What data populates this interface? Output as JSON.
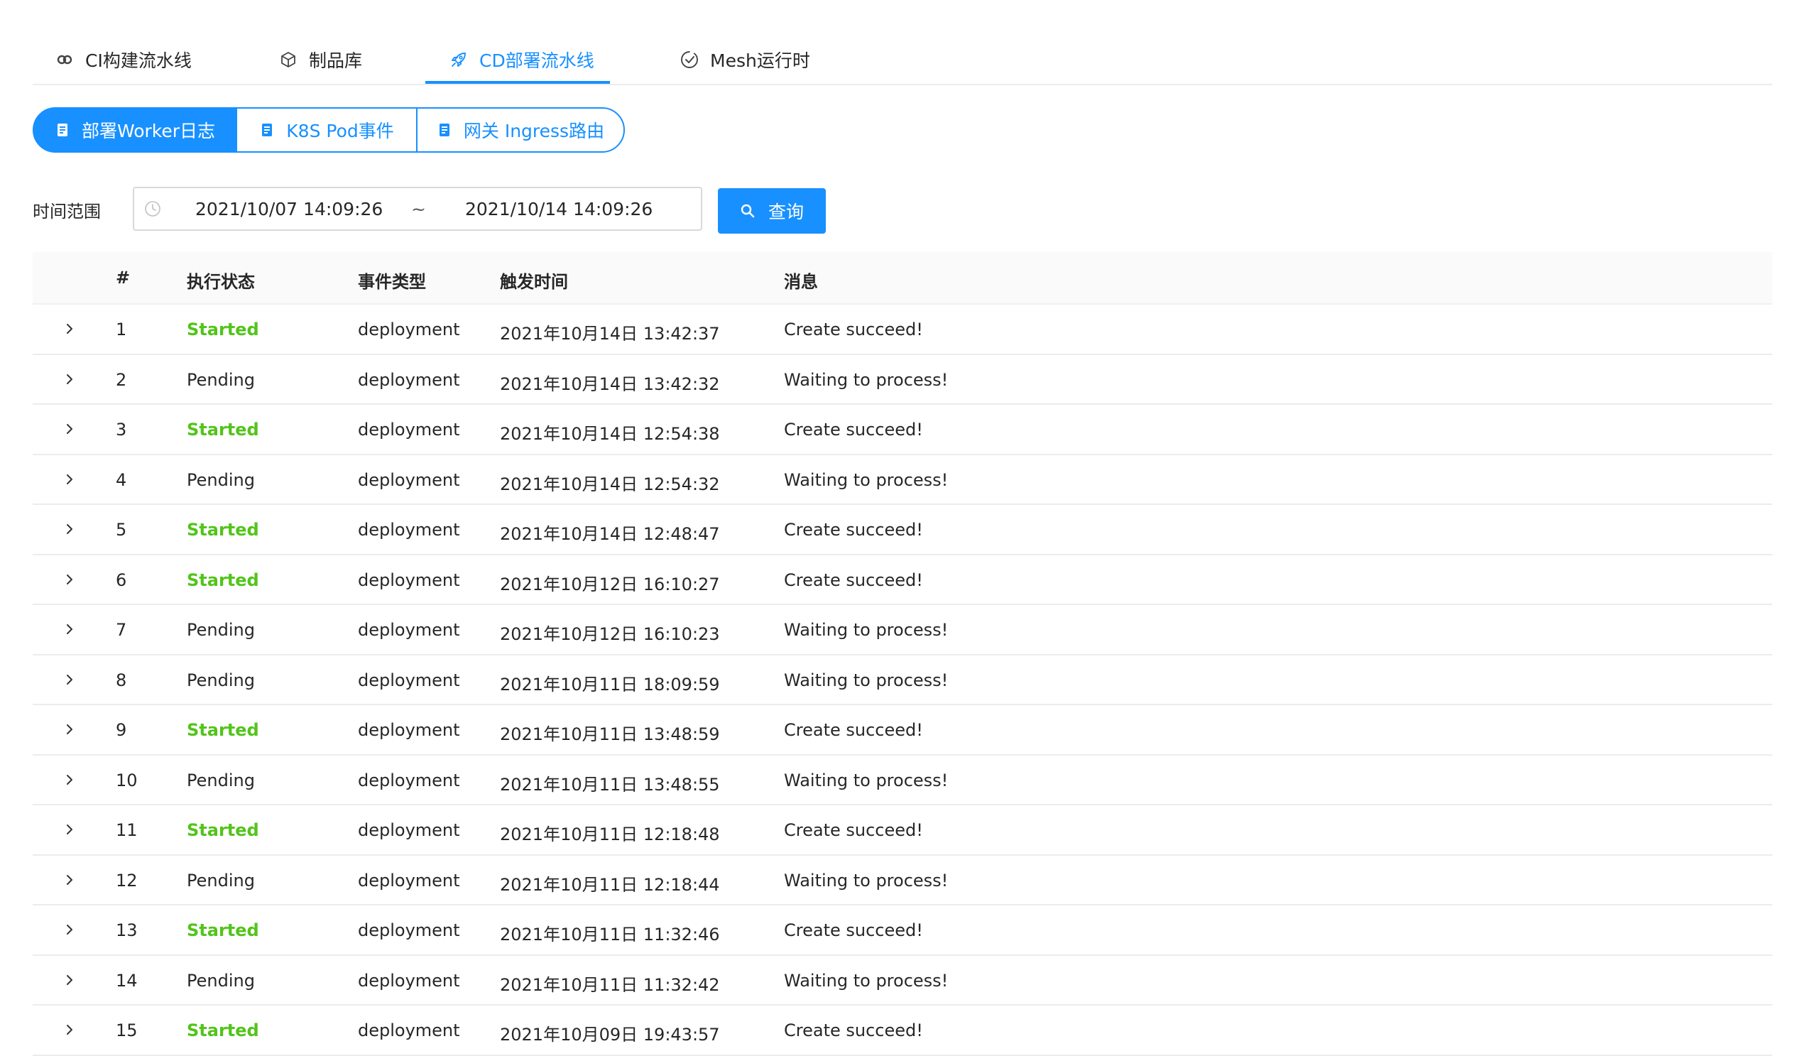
{
  "tabs": [
    {
      "label": "CI构建流水线",
      "icon": "cloud-link-icon",
      "active": false
    },
    {
      "label": "制品库",
      "icon": "cube-icon",
      "active": false
    },
    {
      "label": "CD部署流水线",
      "icon": "rocket-icon",
      "active": true
    },
    {
      "label": "Mesh运行时",
      "icon": "check-circle-icon",
      "active": false
    }
  ],
  "subtabs": [
    {
      "label": "部署Worker日志",
      "icon": "log-icon",
      "active": true
    },
    {
      "label": "K8S Pod事件",
      "icon": "log-icon",
      "active": false
    },
    {
      "label": "网关 Ingress路由",
      "icon": "log-icon",
      "active": false
    }
  ],
  "filter": {
    "label": "时间范围",
    "start": "2021/10/07 14:09:26",
    "separator": "~",
    "end": "2021/10/14 14:09:26",
    "button_label": "查询"
  },
  "table": {
    "headers": {
      "index": "#",
      "status": "执行状态",
      "type": "事件类型",
      "time": "触发时间",
      "message": "消息"
    },
    "rows": [
      {
        "index": "1",
        "status": "Started",
        "type": "deployment",
        "time": "2021年10月14日 13:42:37",
        "message": "Create succeed!"
      },
      {
        "index": "2",
        "status": "Pending",
        "type": "deployment",
        "time": "2021年10月14日 13:42:32",
        "message": "Waiting to process!"
      },
      {
        "index": "3",
        "status": "Started",
        "type": "deployment",
        "time": "2021年10月14日 12:54:38",
        "message": "Create succeed!"
      },
      {
        "index": "4",
        "status": "Pending",
        "type": "deployment",
        "time": "2021年10月14日 12:54:32",
        "message": "Waiting to process!"
      },
      {
        "index": "5",
        "status": "Started",
        "type": "deployment",
        "time": "2021年10月14日 12:48:47",
        "message": "Create succeed!"
      },
      {
        "index": "6",
        "status": "Started",
        "type": "deployment",
        "time": "2021年10月12日 16:10:27",
        "message": "Create succeed!"
      },
      {
        "index": "7",
        "status": "Pending",
        "type": "deployment",
        "time": "2021年10月12日 16:10:23",
        "message": "Waiting to process!"
      },
      {
        "index": "8",
        "status": "Pending",
        "type": "deployment",
        "time": "2021年10月11日 18:09:59",
        "message": "Waiting to process!"
      },
      {
        "index": "9",
        "status": "Started",
        "type": "deployment",
        "time": "2021年10月11日 13:48:59",
        "message": "Create succeed!"
      },
      {
        "index": "10",
        "status": "Pending",
        "type": "deployment",
        "time": "2021年10月11日 13:48:55",
        "message": "Waiting to process!"
      },
      {
        "index": "11",
        "status": "Started",
        "type": "deployment",
        "time": "2021年10月11日 12:18:48",
        "message": "Create succeed!"
      },
      {
        "index": "12",
        "status": "Pending",
        "type": "deployment",
        "time": "2021年10月11日 12:18:44",
        "message": "Waiting to process!"
      },
      {
        "index": "13",
        "status": "Started",
        "type": "deployment",
        "time": "2021年10月11日 11:32:46",
        "message": "Create succeed!"
      },
      {
        "index": "14",
        "status": "Pending",
        "type": "deployment",
        "time": "2021年10月11日 11:32:42",
        "message": "Waiting to process!"
      },
      {
        "index": "15",
        "status": "Started",
        "type": "deployment",
        "time": "2021年10月09日 19:43:57",
        "message": "Create succeed!"
      }
    ]
  },
  "colors": {
    "primary": "#1890ff",
    "started": "#52c41a",
    "divider": "#ececec",
    "header_bg": "#fafafa"
  }
}
